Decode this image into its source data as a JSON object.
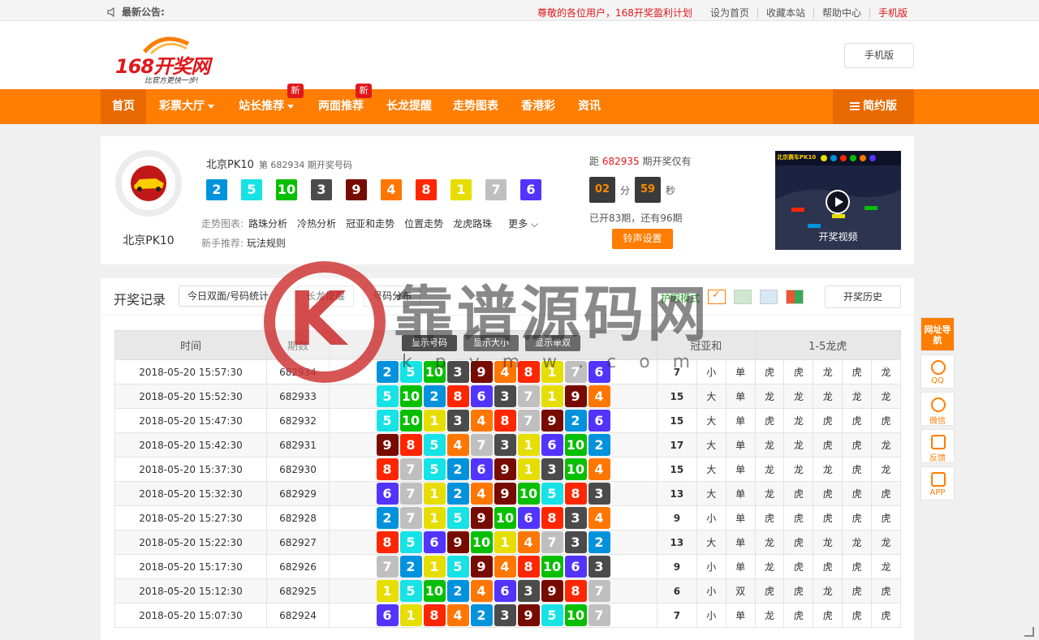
{
  "topbar": {
    "notice": "最新公告:",
    "promo": "尊敬的各位用户，168开奖盈利计划",
    "links": [
      "设为首页",
      "收藏本站",
      "帮助中心",
      "手机版"
    ]
  },
  "header": {
    "logo_main": "168开奖网",
    "logo_slogan": "比官方更快一步!",
    "mobile_button": "手机版"
  },
  "nav": {
    "items": [
      "首页",
      "彩票大厅",
      "站长推荐",
      "两面推荐",
      "长龙提醒",
      "走势图表",
      "香港彩",
      "资讯"
    ],
    "new_badge": "新",
    "simple_version": "简约版"
  },
  "game": {
    "avatar_name": "北京PK10",
    "title": "北京PK10",
    "issue_text": "第 682934 期开奖号码",
    "balls": [
      2,
      5,
      10,
      3,
      9,
      4,
      8,
      1,
      7,
      6
    ],
    "trend_label": "走势图表:",
    "trend_links": [
      "路珠分析",
      "冷热分析",
      "冠亚和走势",
      "位置走势",
      "龙虎路珠"
    ],
    "more": "更多",
    "newbie_label": "新手推荐:",
    "newbie_link": "玩法规则",
    "countdown_prefix": "距",
    "countdown_issue": "682935",
    "countdown_suffix": "期开奖仅有",
    "minutes": "02",
    "minutes_unit": "分",
    "seconds": "59",
    "seconds_unit": "秒",
    "opened_text": "已开83期，还有96期",
    "bell_button": "铃声设置",
    "video_label": "开奖视频",
    "video_logo": "北京赛车PK10"
  },
  "records": {
    "title": "开奖记录",
    "tabs": [
      "今日双面/号码统计",
      "长龙提醒",
      "号码分布"
    ],
    "guard_mode": "护眼模式",
    "history_button": "开奖历史",
    "number_toggles": [
      "显示号码",
      "显示大小",
      "显示单双"
    ],
    "headers": {
      "time": "时间",
      "issue": "期数",
      "sum": "冠亚和",
      "dragon_tiger": "1-5龙虎"
    },
    "rows": [
      {
        "time": "2018-05-20 15:57:30",
        "issue": "682934",
        "nums": [
          2,
          5,
          10,
          3,
          9,
          4,
          8,
          1,
          7,
          6
        ],
        "sum": "7",
        "bs": "小",
        "oe": "单",
        "dt": [
          "虎",
          "虎",
          "龙",
          "虎",
          "龙"
        ]
      },
      {
        "time": "2018-05-20 15:52:30",
        "issue": "682933",
        "nums": [
          5,
          10,
          2,
          8,
          6,
          3,
          7,
          1,
          9,
          4
        ],
        "sum": "15",
        "bs": "大",
        "oe": "单",
        "dt": [
          "龙",
          "龙",
          "龙",
          "龙",
          "龙"
        ]
      },
      {
        "time": "2018-05-20 15:47:30",
        "issue": "682932",
        "nums": [
          5,
          10,
          1,
          3,
          4,
          8,
          7,
          9,
          2,
          6
        ],
        "sum": "15",
        "bs": "大",
        "oe": "单",
        "dt": [
          "虎",
          "龙",
          "虎",
          "虎",
          "虎"
        ]
      },
      {
        "time": "2018-05-20 15:42:30",
        "issue": "682931",
        "nums": [
          9,
          8,
          5,
          4,
          7,
          3,
          1,
          6,
          10,
          2
        ],
        "sum": "17",
        "bs": "大",
        "oe": "单",
        "dt": [
          "龙",
          "龙",
          "虎",
          "虎",
          "龙"
        ]
      },
      {
        "time": "2018-05-20 15:37:30",
        "issue": "682930",
        "nums": [
          8,
          7,
          5,
          2,
          6,
          9,
          1,
          3,
          10,
          4
        ],
        "sum": "15",
        "bs": "大",
        "oe": "单",
        "dt": [
          "龙",
          "龙",
          "龙",
          "虎",
          "龙"
        ]
      },
      {
        "time": "2018-05-20 15:32:30",
        "issue": "682929",
        "nums": [
          6,
          7,
          1,
          2,
          4,
          9,
          10,
          5,
          8,
          3
        ],
        "sum": "13",
        "bs": "大",
        "oe": "单",
        "dt": [
          "龙",
          "虎",
          "虎",
          "虎",
          "虎"
        ]
      },
      {
        "time": "2018-05-20 15:27:30",
        "issue": "682928",
        "nums": [
          2,
          7,
          1,
          5,
          9,
          10,
          6,
          8,
          3,
          4
        ],
        "sum": "9",
        "bs": "小",
        "oe": "单",
        "dt": [
          "虎",
          "虎",
          "虎",
          "虎",
          "虎"
        ]
      },
      {
        "time": "2018-05-20 15:22:30",
        "issue": "682927",
        "nums": [
          8,
          5,
          6,
          9,
          10,
          1,
          4,
          7,
          3,
          2
        ],
        "sum": "13",
        "bs": "大",
        "oe": "单",
        "dt": [
          "龙",
          "虎",
          "龙",
          "龙",
          "龙"
        ]
      },
      {
        "time": "2018-05-20 15:17:30",
        "issue": "682926",
        "nums": [
          7,
          2,
          1,
          5,
          9,
          4,
          8,
          10,
          6,
          3
        ],
        "sum": "9",
        "bs": "小",
        "oe": "单",
        "dt": [
          "龙",
          "虎",
          "虎",
          "虎",
          "龙"
        ]
      },
      {
        "time": "2018-05-20 15:12:30",
        "issue": "682925",
        "nums": [
          1,
          5,
          10,
          2,
          4,
          6,
          3,
          9,
          8,
          7
        ],
        "sum": "6",
        "bs": "小",
        "oe": "双",
        "dt": [
          "虎",
          "虎",
          "龙",
          "虎",
          "虎"
        ]
      },
      {
        "time": "2018-05-20 15:07:30",
        "issue": "682924",
        "nums": [
          6,
          1,
          8,
          4,
          2,
          3,
          9,
          5,
          10,
          7
        ],
        "sum": "7",
        "bs": "小",
        "oe": "单",
        "dt": [
          "龙",
          "虎",
          "虎",
          "虎",
          "虎"
        ]
      }
    ]
  },
  "sidebar": {
    "items": [
      "网址导航",
      "QQ",
      "微信",
      "反馈",
      "APP"
    ]
  },
  "watermark": {
    "letter": "K",
    "text": "靠谱源码网",
    "url": "kpymw.com"
  },
  "colors": {
    "orange": "#ff7d00",
    "b1": "#e6de00",
    "b2": "#0092dd",
    "b3": "#4b4b4b",
    "b4": "#ff7600",
    "b5": "#17e2e5",
    "b6": "#5234ff",
    "b7": "#bfbfbf",
    "b8": "#ff2600",
    "b9": "#780b00",
    "b10": "#07bf00"
  }
}
